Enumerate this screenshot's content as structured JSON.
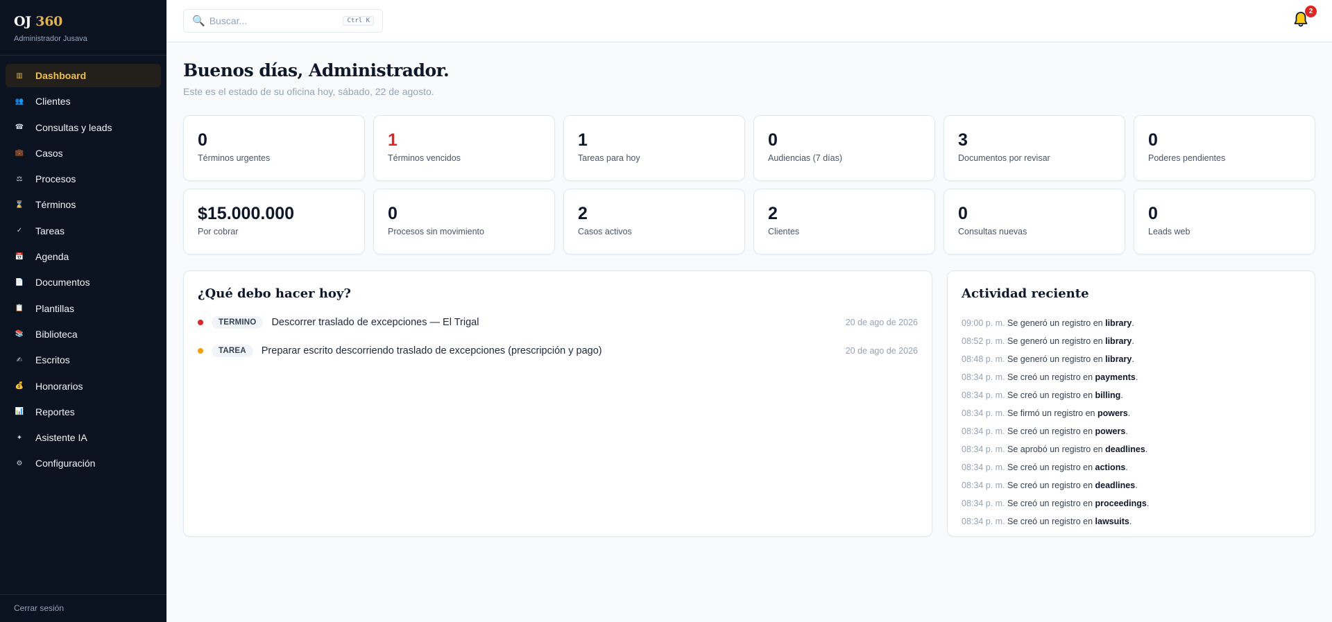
{
  "brand": {
    "logo_main": "OJ",
    "logo_accent": "360",
    "subtitle": "Administrador Jusava"
  },
  "sidebar": {
    "items": [
      {
        "label": "Dashboard",
        "icon": "▥",
        "icon_name": "dashboard-icon",
        "active": true
      },
      {
        "label": "Clientes",
        "icon": "👥",
        "icon_name": "clients-icon"
      },
      {
        "label": "Consultas y leads",
        "icon": "☎",
        "icon_name": "phone-icon"
      },
      {
        "label": "Casos",
        "icon": "💼",
        "icon_name": "briefcase-icon"
      },
      {
        "label": "Procesos",
        "icon": "⚖",
        "icon_name": "scales-icon"
      },
      {
        "label": "Términos",
        "icon": "⌛",
        "icon_name": "hourglass-icon"
      },
      {
        "label": "Tareas",
        "icon": "✓",
        "icon_name": "check-icon"
      },
      {
        "label": "Agenda",
        "icon": "📅",
        "icon_name": "calendar-icon"
      },
      {
        "label": "Documentos",
        "icon": "📄",
        "icon_name": "document-icon"
      },
      {
        "label": "Plantillas",
        "icon": "📋",
        "icon_name": "clipboard-icon"
      },
      {
        "label": "Biblioteca",
        "icon": "📚",
        "icon_name": "books-icon"
      },
      {
        "label": "Escritos",
        "icon": "✍",
        "icon_name": "writing-hand-icon"
      },
      {
        "label": "Honorarios",
        "icon": "💰",
        "icon_name": "money-bag-icon"
      },
      {
        "label": "Reportes",
        "icon": "📊",
        "icon_name": "bar-chart-icon"
      },
      {
        "label": "Asistente IA",
        "icon": "✦",
        "icon_name": "sparkle-icon"
      },
      {
        "label": "Configuración",
        "icon": "⚙",
        "icon_name": "gear-icon"
      }
    ],
    "logout": "Cerrar sesión"
  },
  "topbar": {
    "search_placeholder": "Buscar...",
    "search_shortcut": "Ctrl K",
    "notifications_count": "2"
  },
  "header": {
    "greeting": "Buenos días, Administrador.",
    "subtitle": "Este es el estado de su oficina hoy, sábado, 22 de agosto."
  },
  "stats": [
    {
      "value": "0",
      "label": "Términos urgentes"
    },
    {
      "value": "1",
      "label": "Términos vencidos",
      "alert": true
    },
    {
      "value": "1",
      "label": "Tareas para hoy"
    },
    {
      "value": "0",
      "label": "Audiencias (7 días)"
    },
    {
      "value": "3",
      "label": "Documentos por revisar"
    },
    {
      "value": "0",
      "label": "Poderes pendientes"
    },
    {
      "value": "$15.000.000",
      "label": "Por cobrar"
    },
    {
      "value": "0",
      "label": "Procesos sin movimiento"
    },
    {
      "value": "2",
      "label": "Casos activos"
    },
    {
      "value": "2",
      "label": "Clientes"
    },
    {
      "value": "0",
      "label": "Consultas nuevas"
    },
    {
      "value": "0",
      "label": "Leads web"
    }
  ],
  "today": {
    "title": "¿Qué debo hacer hoy?",
    "items": [
      {
        "type": "TERMINO",
        "title": "Descorrer traslado de excepciones — El Trigal",
        "date": "20 de ago de 2026",
        "dot_color": "#dc2626"
      },
      {
        "type": "TAREA",
        "title": "Preparar escrito descorriendo traslado de excepciones (prescripción y pago)",
        "date": "20 de ago de 2026",
        "dot_color": "#f59e0b"
      }
    ]
  },
  "activity": {
    "title": "Actividad reciente",
    "items": [
      {
        "time": "09:00 p. m.",
        "text": "Se generó un registro en",
        "entity": "library"
      },
      {
        "time": "08:52 p. m.",
        "text": "Se generó un registro en",
        "entity": "library"
      },
      {
        "time": "08:48 p. m.",
        "text": "Se generó un registro en",
        "entity": "library"
      },
      {
        "time": "08:34 p. m.",
        "text": "Se creó un registro en",
        "entity": "payments"
      },
      {
        "time": "08:34 p. m.",
        "text": "Se creó un registro en",
        "entity": "billing"
      },
      {
        "time": "08:34 p. m.",
        "text": "Se firmó un registro en",
        "entity": "powers"
      },
      {
        "time": "08:34 p. m.",
        "text": "Se creó un registro en",
        "entity": "powers"
      },
      {
        "time": "08:34 p. m.",
        "text": "Se aprobó un registro en",
        "entity": "deadlines"
      },
      {
        "time": "08:34 p. m.",
        "text": "Se creó un registro en",
        "entity": "actions"
      },
      {
        "time": "08:34 p. m.",
        "text": "Se creó un registro en",
        "entity": "deadlines"
      },
      {
        "time": "08:34 p. m.",
        "text": "Se creó un registro en",
        "entity": "proceedings"
      },
      {
        "time": "08:34 p. m.",
        "text": "Se creó un registro en",
        "entity": "lawsuits"
      }
    ]
  }
}
